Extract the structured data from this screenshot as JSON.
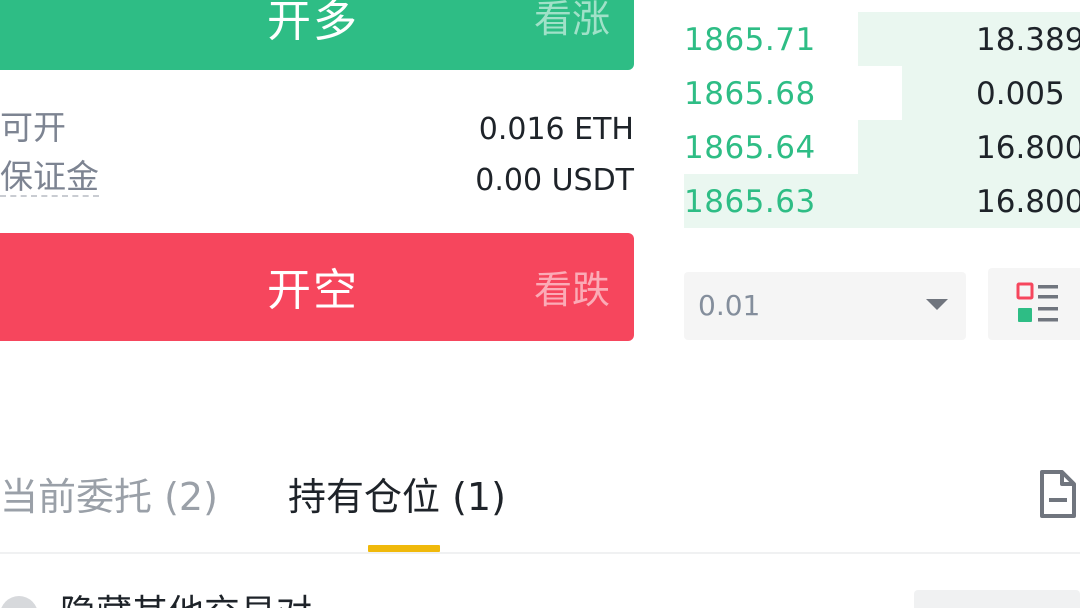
{
  "trade_panel": {
    "long_button": {
      "label": "开多",
      "sub_label": "看涨"
    },
    "short_button": {
      "label": "开空",
      "sub_label": "看跌"
    },
    "available": {
      "label": "可开",
      "value": "0.016 ETH"
    },
    "margin": {
      "label": "保证金",
      "value": "0.00 USDT"
    }
  },
  "order_book": {
    "rows": [
      {
        "price": "1865.71",
        "amount": "18.389",
        "depth_fraction": 0.56
      },
      {
        "price": "1865.68",
        "amount": "0.005",
        "depth_fraction": 0.45
      },
      {
        "price": "1865.64",
        "amount": "16.800",
        "depth_fraction": 0.56
      },
      {
        "price": "1865.63",
        "amount": "16.800",
        "depth_fraction": 1.0
      }
    ],
    "precision": "0.01"
  },
  "tabs": {
    "orders": "当前委托 (2)",
    "positions": "持有仓位 (1)",
    "active": "positions"
  },
  "bottom": {
    "hide_other_pairs": "隐藏其他交易对"
  },
  "colors": {
    "long": "#2ebd85",
    "short": "#f6465d",
    "tab_indicator": "#f0b90b",
    "depth_bar": "#eaf7f0"
  },
  "icons": {
    "precision_caret": "caret-down-icon",
    "view_toggle": "orderbook-layout-icon",
    "history": "document-icon"
  }
}
